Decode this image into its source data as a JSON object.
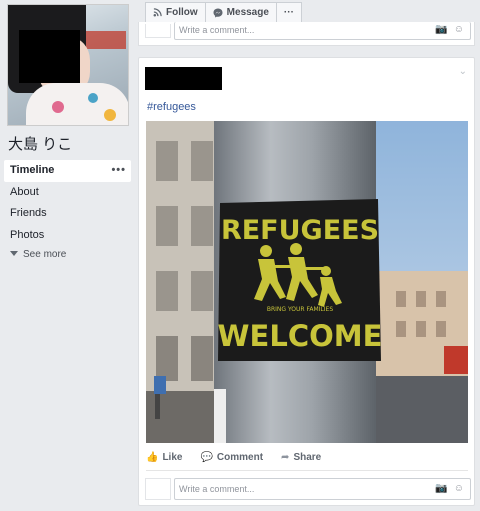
{
  "profile": {
    "name": "大島 りこ"
  },
  "nav": {
    "items": [
      {
        "label": "Timeline",
        "more": "•••"
      },
      {
        "label": "About"
      },
      {
        "label": "Friends"
      },
      {
        "label": "Photos"
      }
    ],
    "see_more": "See more"
  },
  "top_actions": {
    "follow_label": "Follow",
    "message_label": "Message",
    "more_label": "···"
  },
  "top_comment": {
    "placeholder": "Write a comment..."
  },
  "post": {
    "text": "#refugees",
    "photo": {
      "sticker_line1": "REFUGEES",
      "sticker_tagline": "BRING YOUR FAMILIES",
      "sticker_line2": "WELCOME"
    },
    "actions": {
      "like": "Like",
      "comment": "Comment",
      "share": "Share"
    },
    "comment_placeholder": "Write a comment..."
  },
  "colors": {
    "page_bg": "#e9ebee",
    "link_blue": "#365899",
    "sticker_yellow": "#c8c43a"
  },
  "icons": {
    "follow": "rss-icon",
    "message": "messenger-icon",
    "camera": "camera-icon",
    "emoji": "smiley-icon",
    "like": "thumbs-up-icon",
    "comment": "comment-bubble-icon",
    "share": "share-arrow-icon"
  }
}
